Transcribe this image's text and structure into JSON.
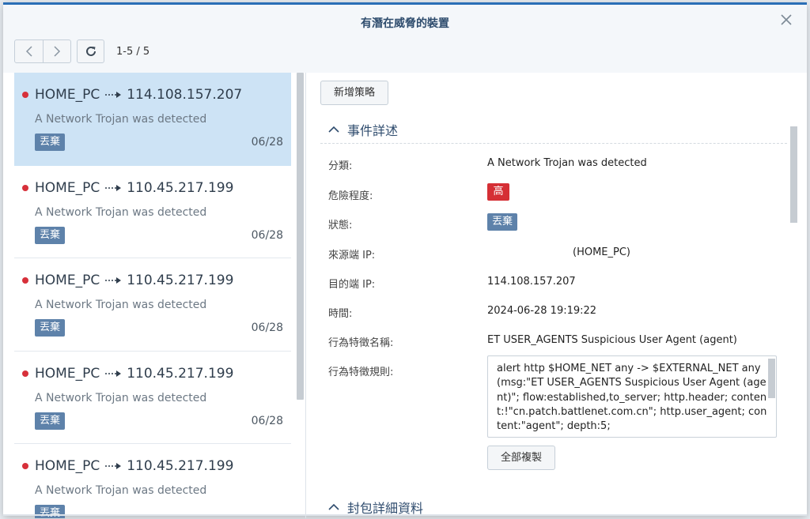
{
  "dialog": {
    "title": "有潛在威脅的裝置",
    "close_icon": "close-icon"
  },
  "toolbar": {
    "prev_icon": "chevron-left-icon",
    "next_icon": "chevron-right-icon",
    "refresh_icon": "refresh-icon",
    "page_count": "1-5 / 5"
  },
  "list": {
    "items": [
      {
        "source": "HOME_PC",
        "dest": "114.108.157.207",
        "desc": "A Network Trojan was detected",
        "status": "丟棄",
        "date": "06/28",
        "selected": true
      },
      {
        "source": "HOME_PC",
        "dest": "110.45.217.199",
        "desc": "A Network Trojan was detected",
        "status": "丟棄",
        "date": "06/28",
        "selected": false
      },
      {
        "source": "HOME_PC",
        "dest": "110.45.217.199",
        "desc": "A Network Trojan was detected",
        "status": "丟棄",
        "date": "06/28",
        "selected": false
      },
      {
        "source": "HOME_PC",
        "dest": "110.45.217.199",
        "desc": "A Network Trojan was detected",
        "status": "丟棄",
        "date": "06/28",
        "selected": false
      },
      {
        "source": "HOME_PC",
        "dest": "110.45.217.199",
        "desc": "A Network Trojan was detected",
        "status": "丟棄",
        "date": "",
        "selected": false
      }
    ],
    "severity_color": "#d7303a"
  },
  "detail": {
    "add_policy_label": "新增策略",
    "section_title": "事件詳述",
    "fields": {
      "category_label": "分類:",
      "category_value": "A Network Trojan was detected",
      "severity_label": "危險程度:",
      "severity_value": "高",
      "status_label": "狀態:",
      "status_value": "丟棄",
      "source_ip_label": "來源端 IP:",
      "source_ip_value": "(HOME_PC)",
      "dest_ip_label": "目的端 IP:",
      "dest_ip_value": "114.108.157.207",
      "time_label": "時間:",
      "time_value": "2024-06-28 19:19:22",
      "signature_name_label": "行為特徵名稱:",
      "signature_name_value": "ET USER_AGENTS Suspicious User Agent (agent)",
      "signature_rule_label": "行為特徵規則:",
      "signature_rule_value": "alert http $HOME_NET any -> $EXTERNAL_NET any (msg:\"ET USER_AGENTS Suspicious User Agent (agent)\"; flow:established,to_server; http.header; content:!\"cn.patch.battlenet.com.cn\"; http.user_agent; content:\"agent\"; depth:5;"
    },
    "copy_all_label": "全部複製",
    "section2_title": "封包詳細資料"
  },
  "colors": {
    "accent": "#2a6fb6",
    "selected_row": "#cde3f5",
    "badge_blue": "#5e82aa",
    "badge_red": "#d52f35"
  }
}
